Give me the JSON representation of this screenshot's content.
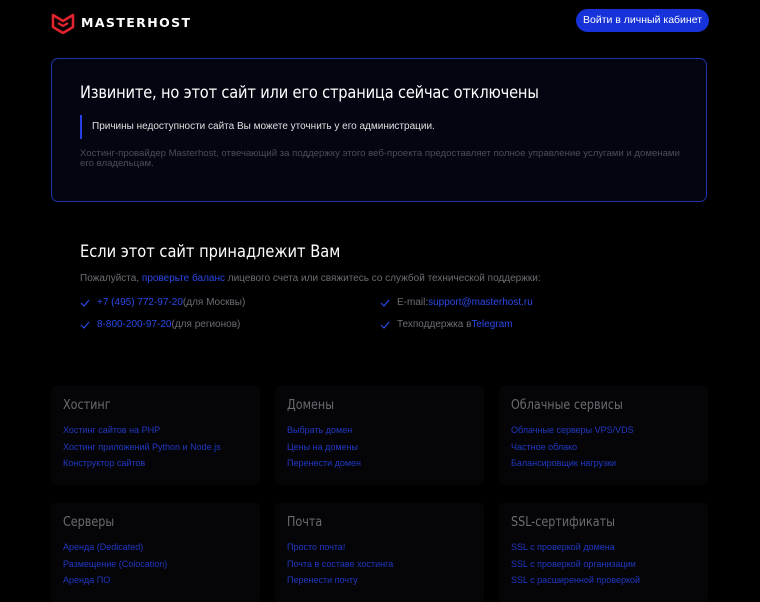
{
  "header": {
    "logo_text": "MASTERHOST",
    "login_label": "Войти в личный кабинет"
  },
  "notice": {
    "title": "Извините, но этот сайт или его страница сейчас отключены",
    "quote": "Причины недоступности сайта Вы можете уточнить у его администрации.",
    "text": "Хостинг-провайдер Masterhost, отвечающий за поддержку этого веб-проекта предоставляет полное управление услугами и доменами его владельцам."
  },
  "owner": {
    "title": "Если этот сайт принадлежит Вам",
    "text_before": "Пожалуйста, ",
    "balance_link": "проверьте баланс",
    "text_after": " лицевого счета или свяжитесь со службой технической поддержки:",
    "contacts": {
      "moscow_phone": "+7 (495) 772-97-20",
      "moscow_note": " (для Москвы)",
      "email_label": "E-mail: ",
      "email": "support@masterhost.ru",
      "regions_phone": "8-800-200-97-20",
      "regions_note": " (для регионов)",
      "support_label": "Техподдержка в ",
      "telegram": "Telegram"
    }
  },
  "cards": [
    {
      "title": "Хостинг",
      "links": [
        "Хостинг сайтов на PHP",
        "Хостинг приложений Python и Node.js",
        "Конструктор сайтов"
      ]
    },
    {
      "title": "Домены",
      "links": [
        "Выбрать домен",
        "Цены на домены",
        "Перенести домен"
      ]
    },
    {
      "title": "Облачные сервисы",
      "links": [
        "Облачные серверы VPS/VDS",
        "Частное облако",
        "Балансировщик нагрузки"
      ]
    },
    {
      "title": "Серверы",
      "links": [
        "Аренда (Dedicated)",
        "Размещение (Colocation)",
        "Аренда ПО"
      ]
    },
    {
      "title": "Почта",
      "links": [
        "Просто почта!",
        "Почта в составе хостинга",
        "Перенести почту"
      ]
    },
    {
      "title": "SSL-сертификаты",
      "links": [
        "SSL с проверкой домена",
        "SSL с проверкой организации",
        "SSL с расширенной проверкой"
      ]
    }
  ],
  "colors": {
    "accent": "#1632d8",
    "logo_red": "#e0242f",
    "link": "#2b49e8"
  }
}
